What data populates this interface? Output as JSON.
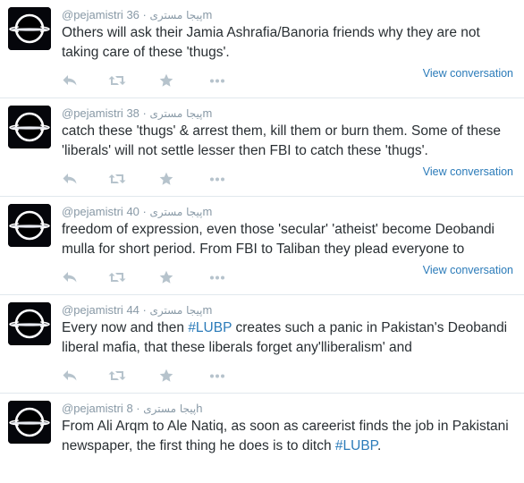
{
  "tweets": [
    {
      "handle": "@pejamistri",
      "name_rtl": "پیجا مستری",
      "time": "36m",
      "text_parts": [
        {
          "t": "Others will ask their Jamia Ashrafia/Banoria friends why they are not taking care of these 'thugs'.",
          "hl": false
        }
      ],
      "view_conversation": "View conversation"
    },
    {
      "handle": "@pejamistri",
      "name_rtl": "پیجا مستری",
      "time": "38m",
      "text_parts": [
        {
          "t": "catch these  'thugs' & arrest them, kill them or burn them. Some of these 'liberals' will not settle lesser then FBI to catch these 'thugs'.",
          "hl": false
        }
      ],
      "view_conversation": "View conversation"
    },
    {
      "handle": "@pejamistri",
      "name_rtl": "پیجا مستری",
      "time": "40m",
      "text_parts": [
        {
          "t": "freedom of expression, even those 'secular' 'atheist' become Deobandi mulla for short period. From FBI to Taliban they plead everyone to",
          "hl": false
        }
      ],
      "view_conversation": "View conversation"
    },
    {
      "handle": "@pejamistri",
      "name_rtl": "پیجا مستری",
      "time": "44m",
      "text_parts": [
        {
          "t": "Every now and then ",
          "hl": false
        },
        {
          "t": "#LUBP",
          "hl": true
        },
        {
          "t": " creates such a panic in Pakistan's Deobandi liberal mafia, that these liberals forget any'lliberalism' and",
          "hl": false
        }
      ],
      "view_conversation": ""
    },
    {
      "handle": "@pejamistri",
      "name_rtl": "پیجا مستری",
      "time": "8h",
      "text_parts": [
        {
          "t": "From Ali Arqm to Ale Natiq, as soon as careerist finds the job in Pakistani newspaper, the first thing he does is to ditch ",
          "hl": false
        },
        {
          "t": "#LUBP",
          "hl": true
        },
        {
          "t": ".",
          "hl": false
        }
      ],
      "view_conversation": ""
    }
  ],
  "icons": {
    "reply": "reply-icon",
    "retweet": "retweet-icon",
    "favorite": "star-icon",
    "more": "more-icon",
    "avatar": "black-hole-avatar"
  },
  "colors": {
    "muted": "#8899a6",
    "text": "#292f33",
    "link": "#2b7bb9",
    "icon": "#b6c3cc",
    "divider": "#e1e8ed"
  }
}
